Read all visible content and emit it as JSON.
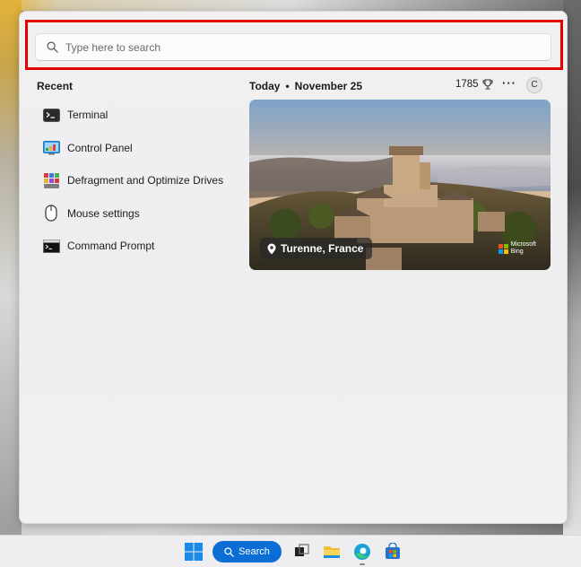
{
  "search": {
    "placeholder": "Type here to search",
    "icon": "search-icon"
  },
  "recent": {
    "title": "Recent",
    "items": [
      {
        "label": "Terminal",
        "icon": "terminal-icon"
      },
      {
        "label": "Control Panel",
        "icon": "control-panel-icon"
      },
      {
        "label": "Defragment and Optimize Drives",
        "icon": "defragment-icon"
      },
      {
        "label": "Mouse settings",
        "icon": "mouse-icon"
      },
      {
        "label": "Command Prompt",
        "icon": "command-prompt-icon"
      }
    ]
  },
  "today": {
    "label": "Today",
    "separator": "•",
    "date": "November 25",
    "points": "1785",
    "points_icon": "trophy-icon",
    "more_label": "···",
    "avatar_letter": "C"
  },
  "card": {
    "location": "Turenne, France",
    "brand_line1": "Microsoft",
    "brand_line2": "Bing"
  },
  "taskbar": {
    "search_label": "Search",
    "apps": [
      "start-icon",
      "task-view-icon",
      "file-explorer-icon",
      "edge-icon",
      "store-icon"
    ]
  },
  "colors": {
    "highlight": "#e30000",
    "accent": "#0b6ed4"
  }
}
